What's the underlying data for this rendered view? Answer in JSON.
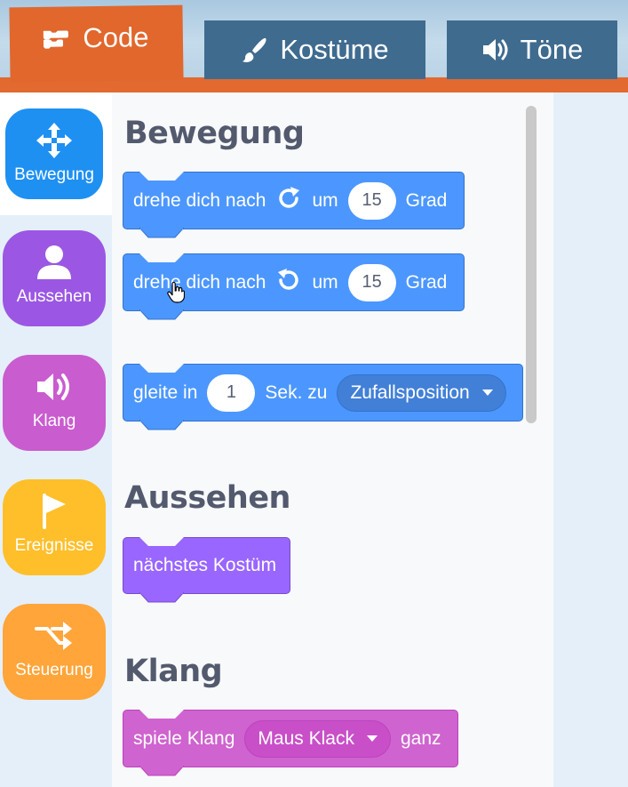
{
  "tabs": {
    "code": "Code",
    "costumes": "Kostüme",
    "sounds": "Töne"
  },
  "categories": [
    {
      "label": "Bewegung",
      "icon": "move-arrows-icon",
      "color": "#1e90f2",
      "selected": true
    },
    {
      "label": "Aussehen",
      "icon": "person-icon",
      "color": "#9b57e3"
    },
    {
      "label": "Klang",
      "icon": "speaker-icon",
      "color": "#c95ccf"
    },
    {
      "label": "Ereignisse",
      "icon": "flag-icon",
      "color": "#ffbf2a"
    },
    {
      "label": "Steuerung",
      "icon": "shuffle-arrows-icon",
      "color": "#ffa53a"
    }
  ],
  "palette": {
    "sections": {
      "motion": "Bewegung",
      "looks": "Aussehen",
      "sound": "Klang"
    },
    "blocks": {
      "turn_right": {
        "prefix": "drehe dich nach",
        "icon": "rotate-right-icon",
        "mid": "um",
        "value": "15",
        "suffix": "Grad"
      },
      "turn_left": {
        "prefix": "drehe dich nach",
        "icon": "rotate-left-icon",
        "mid": "um",
        "value": "15",
        "suffix": "Grad"
      },
      "glide": {
        "prefix": "gleite in",
        "value": "1",
        "mid": "Sek. zu",
        "option": "Zufallsposition"
      },
      "next_costume": {
        "label": "nächstes Kostüm"
      },
      "play_sound": {
        "prefix": "spiele Klang",
        "option": "Maus Klack",
        "suffix": "ganz"
      }
    }
  },
  "colors": {
    "motion_block": "#4c97ff",
    "looks_block": "#9966ff",
    "sound_block": "#cf63cf",
    "active_tab": "#e1672d",
    "inactive_tab": "#3f6b8f"
  }
}
